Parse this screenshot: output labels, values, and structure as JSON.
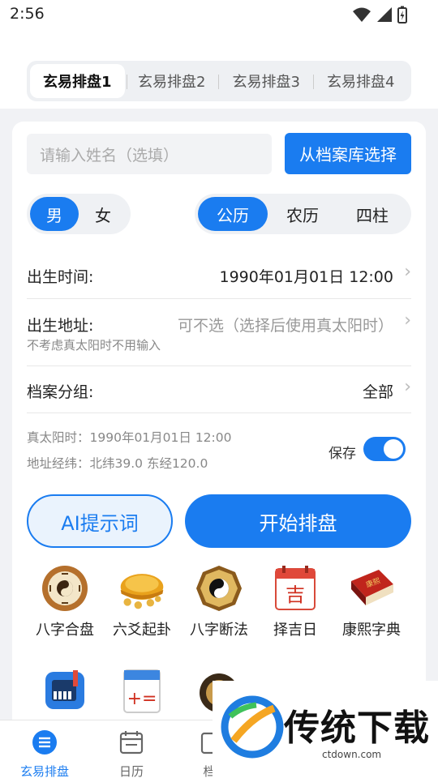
{
  "status": {
    "time": "2:56"
  },
  "tabs": [
    {
      "label": "玄易排盘1",
      "active": true
    },
    {
      "label": "玄易排盘2",
      "active": false
    },
    {
      "label": "玄易排盘3",
      "active": false
    },
    {
      "label": "玄易排盘4",
      "active": false
    }
  ],
  "form": {
    "name_placeholder": "请输入姓名（选填）",
    "archive_button": "从档案库选择",
    "gender": {
      "male": "男",
      "female": "女",
      "selected": "男"
    },
    "calendar": {
      "solar": "公历",
      "lunar": "农历",
      "pillars": "四柱",
      "selected": "公历"
    },
    "birth_time": {
      "label": "出生时间:",
      "value": "1990年01月01日 12:00"
    },
    "birth_place": {
      "label": "出生地址:",
      "value": "可不选（选择后使用真太阳时）",
      "hint": "不考虑真太阳时不用输入"
    },
    "group": {
      "label": "档案分组:",
      "value": "全部"
    },
    "true_solar": "真太阳时：1990年01月01日 12:00",
    "coords": "地址经纬：北纬39.0 东经120.0",
    "save_label": "保存",
    "save_on": true,
    "ai_button": "AI提示词",
    "start_button": "开始排盘"
  },
  "tools": [
    {
      "label": "八字合盘",
      "icon": "bagua-plate-icon"
    },
    {
      "label": "六爻起卦",
      "icon": "tortoise-coins-icon"
    },
    {
      "label": "八字断法",
      "icon": "yinyang-compass-icon"
    },
    {
      "label": "择吉日",
      "icon": "lucky-calendar-icon"
    },
    {
      "label": "康熙字典",
      "icon": "dictionary-book-icon"
    }
  ],
  "tools_row2": [
    {
      "icon": "keyboard-app-icon"
    },
    {
      "icon": "calendar-numbers-icon"
    },
    {
      "icon": "luopan-icon"
    },
    {
      "icon": "red-envelope-icon"
    },
    {
      "icon": "candle-icon"
    }
  ],
  "nav": [
    {
      "label": "玄易排盘",
      "icon": "list-icon",
      "active": true
    },
    {
      "label": "日历",
      "icon": "calendar-icon",
      "active": false
    },
    {
      "label": "档",
      "icon": "archive-icon",
      "active": false
    }
  ],
  "watermark": {
    "title": "传统下载",
    "url": "ctdown.com"
  },
  "colors": {
    "accent": "#1a7cf0",
    "background": "#f1f2f5"
  }
}
